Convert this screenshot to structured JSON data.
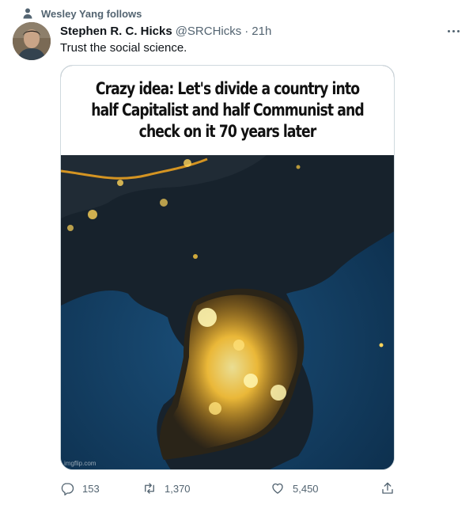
{
  "social_context": {
    "text": "Wesley Yang follows",
    "icon": "person-icon"
  },
  "author": {
    "display_name": "Stephen R. C. Hicks",
    "handle": "@SRCHicks",
    "separator": "·",
    "time": "21h"
  },
  "tweet": {
    "text": "Trust the social science."
  },
  "media": {
    "caption": "Crazy idea:  Let's divide a country into half Capitalist and half Communist and check on it 70 years later",
    "watermark": "imgflip.com"
  },
  "actions": {
    "reply": {
      "icon": "reply-icon",
      "count": "153"
    },
    "retweet": {
      "icon": "retweet-icon",
      "count": "1,370"
    },
    "like": {
      "icon": "heart-icon",
      "count": "5,450"
    },
    "share": {
      "icon": "share-icon"
    }
  },
  "colors": {
    "text": "#0f1419",
    "secondary": "#536471",
    "border": "#cfd9de",
    "sea": "#12385a",
    "land": "#1a2530",
    "lights": "#ffc83c"
  }
}
